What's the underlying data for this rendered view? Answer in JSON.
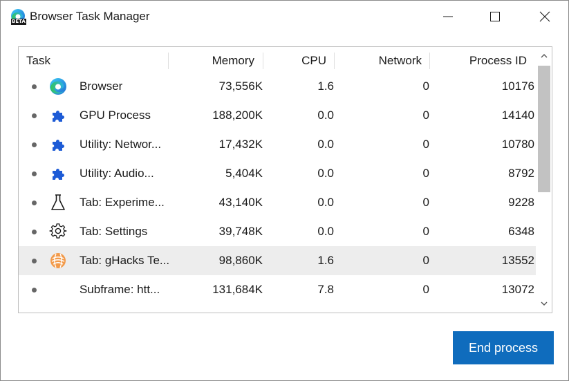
{
  "window": {
    "title": "Browser Task Manager",
    "app_icon": "edge-beta-icon",
    "app_icon_badge": "BETA",
    "controls": [
      "minimize-icon",
      "maximize-icon",
      "close-icon"
    ]
  },
  "table": {
    "columns": {
      "task": "Task",
      "memory": "Memory",
      "cpu": "CPU",
      "network": "Network",
      "pid": "Process ID"
    },
    "rows": [
      {
        "task": "Browser",
        "memory": "73,556K",
        "cpu": "1.6",
        "network": "0",
        "pid": "10176",
        "icon": "edge-icon"
      },
      {
        "task": "GPU Process",
        "memory": "188,200K",
        "cpu": "0.0",
        "network": "0",
        "pid": "14140",
        "icon": "puzzle-icon"
      },
      {
        "task": "Utility: Networ...",
        "memory": "17,432K",
        "cpu": "0.0",
        "network": "0",
        "pid": "10780",
        "icon": "puzzle-icon"
      },
      {
        "task": "Utility: Audio...",
        "memory": "5,404K",
        "cpu": "0.0",
        "network": "0",
        "pid": "8792",
        "icon": "puzzle-icon"
      },
      {
        "task": "Tab: Experime...",
        "memory": "43,140K",
        "cpu": "0.0",
        "network": "0",
        "pid": "9228",
        "icon": "flask-icon"
      },
      {
        "task": "Tab: Settings",
        "memory": "39,748K",
        "cpu": "0.0",
        "network": "0",
        "pid": "6348",
        "icon": "gear-icon"
      },
      {
        "task": "Tab: gHacks Te...",
        "memory": "98,860K",
        "cpu": "1.6",
        "network": "0",
        "pid": "13552",
        "icon": "ghacks-favicon",
        "selected": true
      },
      {
        "task": "Subframe: htt...",
        "memory": "131,684K",
        "cpu": "7.8",
        "network": "0",
        "pid": "13072",
        "icon": ""
      }
    ]
  },
  "actions": {
    "end_process": "End process"
  },
  "colors": {
    "accent": "#0f6cbd",
    "selected_row": "#ededed",
    "puzzle_blue": "#1d5bd6"
  }
}
